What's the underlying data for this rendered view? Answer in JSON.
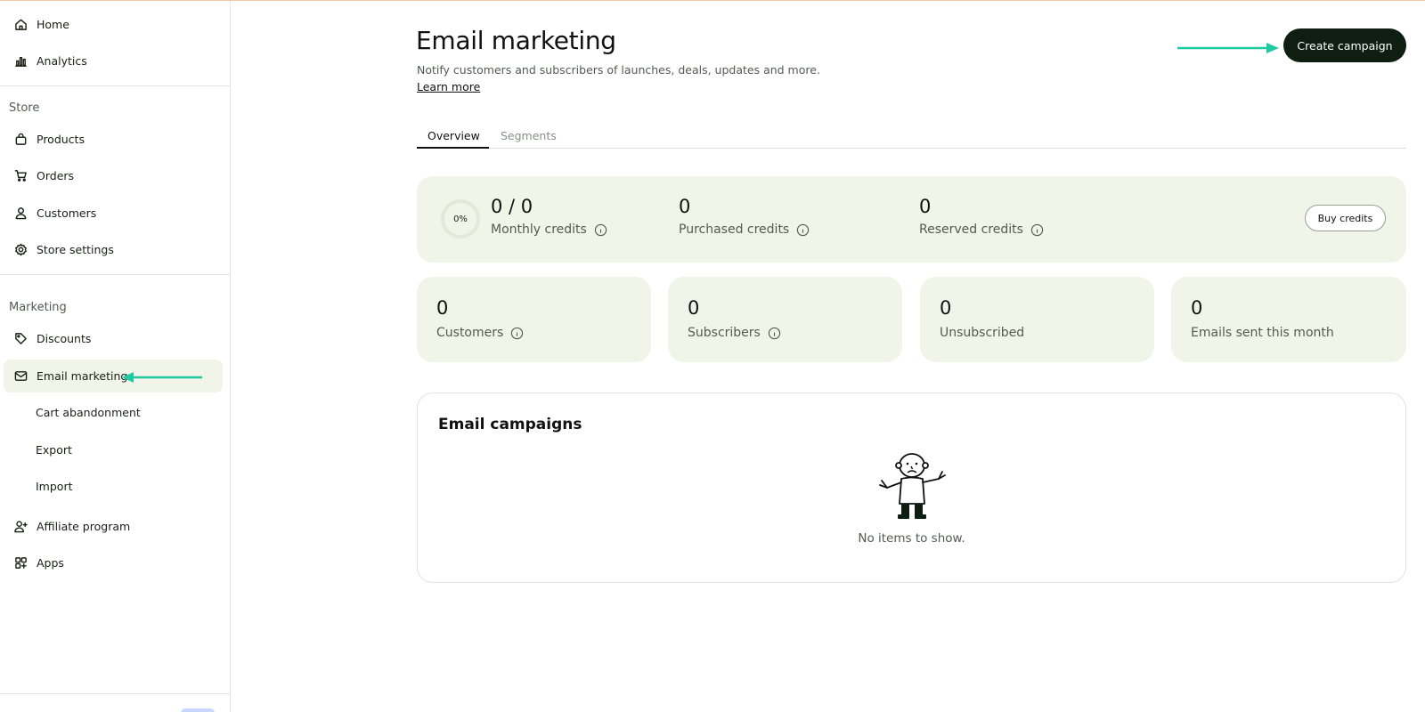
{
  "sidebar": {
    "top_items": [
      {
        "label": "Home",
        "icon": "home-icon"
      },
      {
        "label": "Analytics",
        "icon": "analytics-icon"
      }
    ],
    "store_section": "Store",
    "store_items": [
      {
        "label": "Products",
        "icon": "shopping-bag-icon"
      },
      {
        "label": "Orders",
        "icon": "cart-icon"
      },
      {
        "label": "Customers",
        "icon": "user-icon"
      },
      {
        "label": "Store settings",
        "icon": "gear-icon"
      }
    ],
    "marketing_section": "Marketing",
    "marketing_items": [
      {
        "label": "Discounts",
        "icon": "tag-icon"
      },
      {
        "label": "Email marketing",
        "icon": "envelope-icon",
        "active": true
      },
      {
        "label": "Cart abandonment"
      },
      {
        "label": "Export"
      },
      {
        "label": "Import"
      }
    ],
    "bottom_items": [
      {
        "label": "Affiliate program",
        "icon": "user-plus-icon"
      },
      {
        "label": "Apps",
        "icon": "apps-grid-icon"
      }
    ]
  },
  "header": {
    "title": "Email marketing",
    "subtitle": "Notify customers and subscribers of launches, deals, updates and more.",
    "learn_more": "Learn more",
    "create_button": "Create campaign"
  },
  "tabs": [
    {
      "label": "Overview",
      "active": true
    },
    {
      "label": "Segments",
      "active": false
    }
  ],
  "credits": {
    "progress_label": "0%",
    "progress_fraction": 0,
    "monthly_value": "0 / 0",
    "monthly_label": "Monthly credits",
    "purchased_value": "0",
    "purchased_label": "Purchased credits",
    "reserved_value": "0",
    "reserved_label": "Reserved credits",
    "buy_button": "Buy credits"
  },
  "stats": [
    {
      "value": "0",
      "label": "Customers",
      "info": true
    },
    {
      "value": "0",
      "label": "Subscribers",
      "info": true
    },
    {
      "value": "0",
      "label": "Unsubscribed",
      "info": false
    },
    {
      "value": "0",
      "label": "Emails sent this month",
      "info": false
    }
  ],
  "campaigns": {
    "title": "Email campaigns",
    "empty_text": "No items to show."
  },
  "colors": {
    "accent_dark": "#0e1f12",
    "card_bg": "#f1f4e8",
    "annotation_arrow": "#1fc9a2"
  }
}
